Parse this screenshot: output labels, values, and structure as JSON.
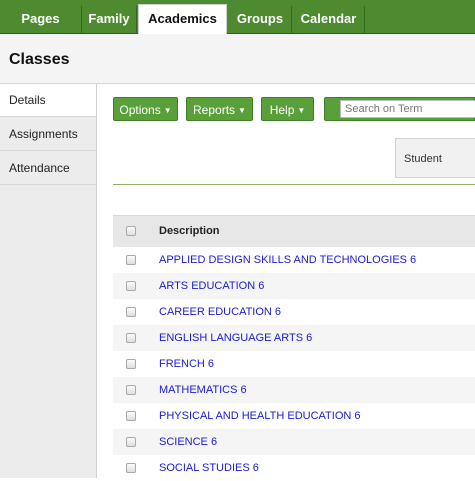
{
  "top_tabs": [
    {
      "label": "Pages",
      "active": false
    },
    {
      "label": "Family",
      "active": false
    },
    {
      "label": "Academics",
      "active": true
    },
    {
      "label": "Groups",
      "active": false
    },
    {
      "label": "Calendar",
      "active": false
    }
  ],
  "header": {
    "title": "Classes"
  },
  "sidenav": {
    "items": [
      {
        "label": "Details",
        "active": true
      },
      {
        "label": "Assignments",
        "active": false
      },
      {
        "label": "Attendance",
        "active": false
      }
    ]
  },
  "toolbar": {
    "options_label": "Options",
    "reports_label": "Reports",
    "help_label": "Help",
    "search_placeholder": "Search on Term"
  },
  "filter": {
    "student_label": "Student"
  },
  "table": {
    "column_header": "Description",
    "rows": [
      "APPLIED DESIGN SKILLS AND TECHNOLOGIES 6",
      "ARTS EDUCATION 6",
      "CAREER EDUCATION 6",
      "ENGLISH LANGUAGE ARTS 6",
      "FRENCH 6",
      "MATHEMATICS 6",
      "PHYSICAL AND HEALTH EDUCATION 6",
      "SCIENCE 6",
      "SOCIAL STUDIES 6"
    ]
  },
  "colors": {
    "brand_green": "#4e8a2f",
    "button_green": "#5aa03a",
    "link_blue": "#1a1ad6"
  }
}
